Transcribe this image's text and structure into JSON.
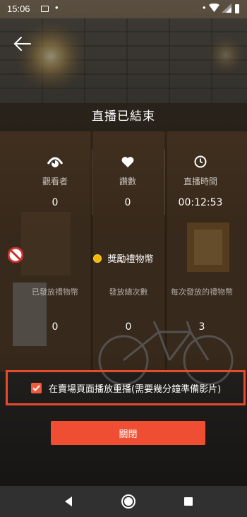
{
  "status_bar": {
    "time": "15:06",
    "left_dot": "•",
    "right_dot": "•",
    "icons": [
      "message-icon",
      "wifi-icon",
      "signal-icon",
      "battery-icon"
    ]
  },
  "header": {
    "back_icon": "back-arrow-icon",
    "title": "直播已結束"
  },
  "stats": [
    {
      "icon": "eye-icon",
      "label": "觀看者",
      "value": "0"
    },
    {
      "icon": "heart-icon",
      "label": "讚數",
      "value": "0"
    },
    {
      "icon": "clock-icon",
      "label": "直播時間",
      "value": "00:12:53"
    }
  ],
  "reward": {
    "icon": "coin-icon",
    "heading": "獎勵禮物幣",
    "columns": [
      {
        "label": "已發放禮物幣",
        "value": "0"
      },
      {
        "label": "發放總次數",
        "value": "0"
      },
      {
        "label": "每次發放的禮物幣",
        "value": "3"
      }
    ]
  },
  "replay": {
    "checked": true,
    "label": "在賣場頁面播放重播(需要幾分鐘準備影片)"
  },
  "close_button": {
    "label": "關閉"
  },
  "colors": {
    "accent": "#f04e32",
    "highlight_border": "#e84a2e",
    "coin": "#f5b700"
  },
  "nav_bar": {
    "icons": [
      "nav-back-icon",
      "nav-home-icon",
      "nav-recents-icon"
    ]
  }
}
